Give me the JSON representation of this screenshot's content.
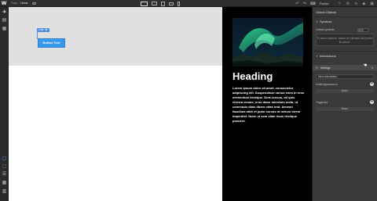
{
  "topbar": {
    "logo": "W",
    "page_label": "Page:",
    "page_value": "Home",
    "undo_icon": "undo-icon",
    "redo_icon": "redo-icon",
    "publish_label": "Publish"
  },
  "canvas": {
    "element_tag": "Link",
    "element_gear": "⚙",
    "button_text": "Button Text",
    "heading": "Heading",
    "paragraph": "Lorem ipsum dolor sit amet, consectetur adipiscing elit. Suspendisse varius enim in eros elementum tristique. Duis cursus, mi quis viverra ornare, eros dolor interdum nulla, ut commodo diam libero vitae erat. Aenean faucibus nibh et justo cursus id rutrum lorem imperdiet. Nunc ut sem vitae risus tristique posuere."
  },
  "panel": {
    "title": "Global Objects",
    "symbols_label": "Symbols",
    "global_symbols_label": "Global symbols",
    "symbols_hint": "To add a symbol, select an element and press ⌘ above.",
    "interactions_label": "Interactions",
    "settings_label": "Settings",
    "new_interaction_label": "New Interaction",
    "initial_appearance_label": "Initial Appearance",
    "none_label_1": "None",
    "triggers_label": "Trigger(s)",
    "none_label_2": "None"
  }
}
